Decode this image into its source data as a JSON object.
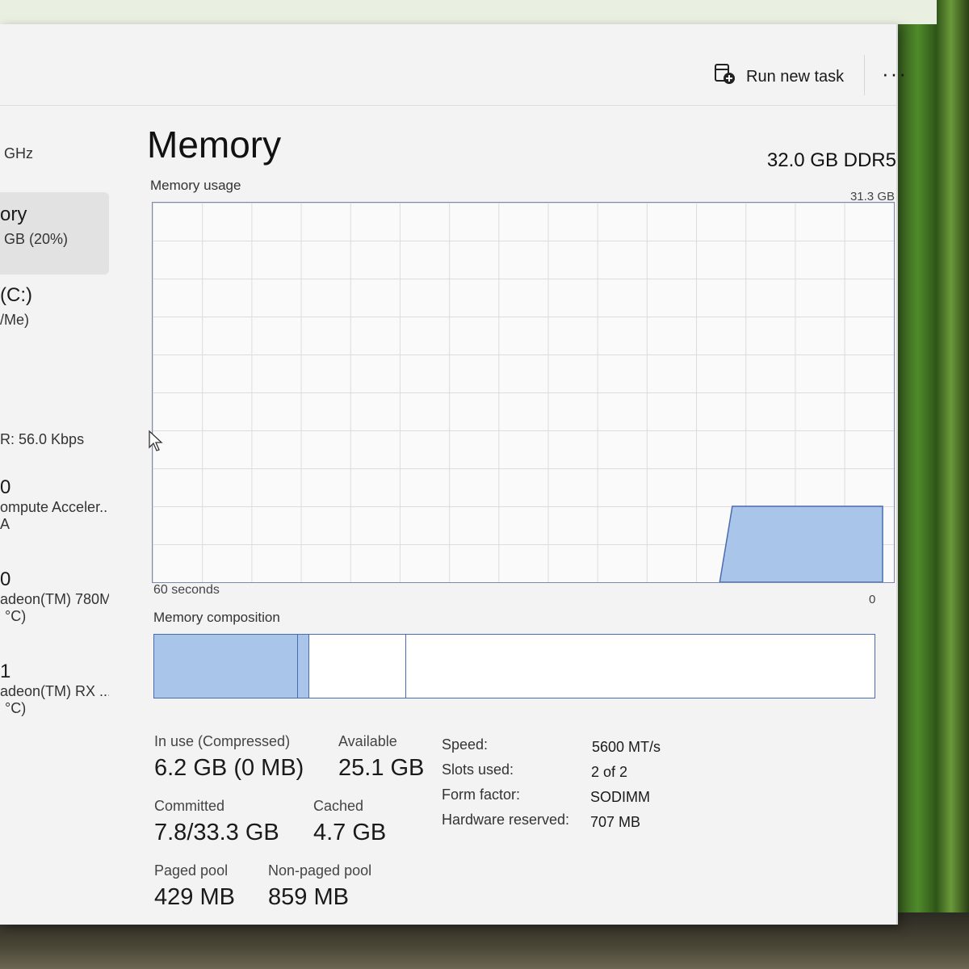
{
  "toolbar": {
    "run_new_task": "Run new task",
    "more": "···"
  },
  "sidebar": {
    "items": [
      {
        "line1": "GHz",
        "line2": ""
      },
      {
        "line1": "ory",
        "line2": "GB (20%)"
      },
      {
        "line1": "(C:)",
        "line2": "/Me)"
      },
      {
        "line1": "R: 56.0 Kbps",
        "line2": ""
      },
      {
        "line1": "0",
        "line2": "ompute Acceler..",
        "line3": "A"
      },
      {
        "line1": "0",
        "line2": "adeon(TM) 780M",
        "line3": "°C)"
      },
      {
        "line1": "1",
        "line2": "adeon(TM) RX ...",
        "line3": "°C)"
      }
    ]
  },
  "main": {
    "title": "Memory",
    "spec": "32.0 GB DDR5",
    "usage_label": "Memory usage",
    "usage_max": "31.3 GB",
    "axis_left": "60 seconds",
    "axis_right": "0",
    "composition_label": "Memory composition",
    "composition": {
      "in_use_fraction": 0.2,
      "modified_fraction": 0.015,
      "standby_fraction": 0.135,
      "free_fraction": 0.65
    },
    "usage_level_fraction": 0.2,
    "stats": {
      "in_use_label": "In use (Compressed)",
      "in_use_value": "6.2 GB (0 MB)",
      "available_label": "Available",
      "available_value": "25.1 GB",
      "committed_label": "Committed",
      "committed_value": "7.8/33.3 GB",
      "cached_label": "Cached",
      "cached_value": "4.7 GB",
      "paged_label": "Paged pool",
      "paged_value": "429 MB",
      "nonpaged_label": "Non-paged pool",
      "nonpaged_value": "859 MB"
    },
    "details": {
      "speed_label": "Speed:",
      "speed_value": "5600 MT/s",
      "slots_label": "Slots used:",
      "slots_value": "2 of 2",
      "form_label": "Form factor:",
      "form_value": "SODIMM",
      "hw_label": "Hardware reserved:",
      "hw_value": "707 MB"
    }
  },
  "colors": {
    "fill": "#a9c6ea",
    "border": "#4a6bb0"
  }
}
